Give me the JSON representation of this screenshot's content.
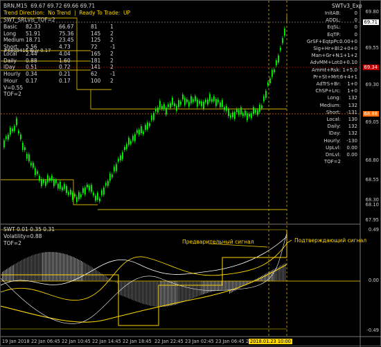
{
  "chart_header": {
    "symbol_line": "BRN,M15  69.67 69.72 69.66 69.71",
    "trend_line": "Trend Direction:  No Trend  |  Ready To Trade:  UP",
    "indicator_label": "SWT_SRLvls_TOF=2"
  },
  "left_table": {
    "rows": [
      {
        "name": "Basic",
        "a": "82.33",
        "b": "66.67",
        "c": "81",
        "d": "1"
      },
      {
        "name": "Long",
        "a": "51.91",
        "b": "75.36",
        "c": "145",
        "d": "2"
      },
      {
        "name": "Medium",
        "a": "18.71",
        "b": "23.45",
        "c": "125",
        "d": "2"
      },
      {
        "name": "Short",
        "a": "5.56",
        "b": "4.73",
        "c": "72",
        "d": "-1"
      },
      {
        "name": "Local",
        "a": "2.44",
        "b": "4.04",
        "c": "165",
        "d": "2"
      },
      {
        "name": "Daily",
        "a": "0.88",
        "b": "1.60",
        "c": "181",
        "d": "2"
      },
      {
        "name": "lDay",
        "a": "0.51",
        "b": "0.72",
        "c": "141",
        "d": "2"
      },
      {
        "name": "Hourly",
        "a": "0.34",
        "b": "0.21",
        "c": "62",
        "d": "-1"
      },
      {
        "name": "lHour",
        "a": "0.17",
        "b": "0.17",
        "c": "100",
        "d": "2"
      }
    ],
    "overlay_text": "#6809416 Buy 0.17",
    "v_text": "V=0.55",
    "tof_text": "TOF=2"
  },
  "right_panel": {
    "title": "SWTv3_Exp",
    "rows": [
      {
        "label": "InitAB:",
        "value": "0"
      },
      {
        "label": "ADDL:",
        "value": "0"
      },
      {
        "label": "EqSL:",
        "value": "0"
      },
      {
        "label": "EqTP:",
        "value": "0"
      },
      {
        "label": "GrSF+EqtpPc:",
        "value": "0.00+0"
      },
      {
        "label": "Sig+Hr+Bl:",
        "value": "2+0+0"
      },
      {
        "label": "Man+Gr+N:",
        "value": "1+1+2"
      },
      {
        "label": "AdvMM+Lot:",
        "value": "0+0.10"
      },
      {
        "label": "Ammt+Rsk:",
        "value": "1+5.0"
      },
      {
        "label": "Pr+St+Mrt:",
        "value": "6+4+1"
      },
      {
        "label": "AdTrS+Br:",
        "value": "1+0"
      },
      {
        "label": "ChSP+Lrc:",
        "value": "1+0"
      },
      {
        "label": "Long:",
        "value": "132"
      },
      {
        "label": "Medium:",
        "value": "132"
      },
      {
        "label": "Short:",
        "value": "-131"
      },
      {
        "label": "Local:",
        "value": "130"
      },
      {
        "label": "Daily:",
        "value": "132"
      },
      {
        "label": "lDay:",
        "value": "132"
      },
      {
        "label": "Hourly:",
        "value": "-130"
      },
      {
        "label": "UpLvl:",
        "value": "0.00"
      },
      {
        "label": "DnLvl:",
        "value": "0.00"
      },
      {
        "label": "TOF=2",
        "value": ""
      }
    ]
  },
  "price_axis": {
    "ticks": [
      "69.80",
      "69.55",
      "69.30",
      "69.05",
      "68.80",
      "68.55",
      "68.30",
      "68.10",
      "67.95"
    ],
    "current_price": "69.71",
    "level_red": "69.34",
    "level_orange": "68.88"
  },
  "oscillator": {
    "header": "SWT 0.01 0.35 0.31",
    "volatility_text": "Volatility=0.88",
    "tof_text": "TOF=2",
    "axis_top": "0.49",
    "axis_mid": "0.00",
    "axis_bottom": "-0.49",
    "annotation_pre": "Предварительный сигнал",
    "annotation_confirm": "Подтверждающий сигнал"
  },
  "time_axis": {
    "labels": [
      "19 Jan 2018",
      "22 Jan 06:45",
      "22 Jan 10:45",
      "22 Jan 14:45",
      "22 Jan 18:45",
      "22 Jan 22:45",
      "23 Jan 02:45",
      "23 Jan 06:45",
      "23 Jan 10:45"
    ],
    "highlight": "2018.01.23 10:00"
  },
  "colors": {
    "background": "#000000",
    "bull_candle": "#00ff00",
    "level_yellow": "#d4b000",
    "oscillator_orange": "#c86414",
    "oscillator_cyan": "#7fd4e0",
    "red_level": "#c00000",
    "orange_level": "#ff6a00"
  }
}
